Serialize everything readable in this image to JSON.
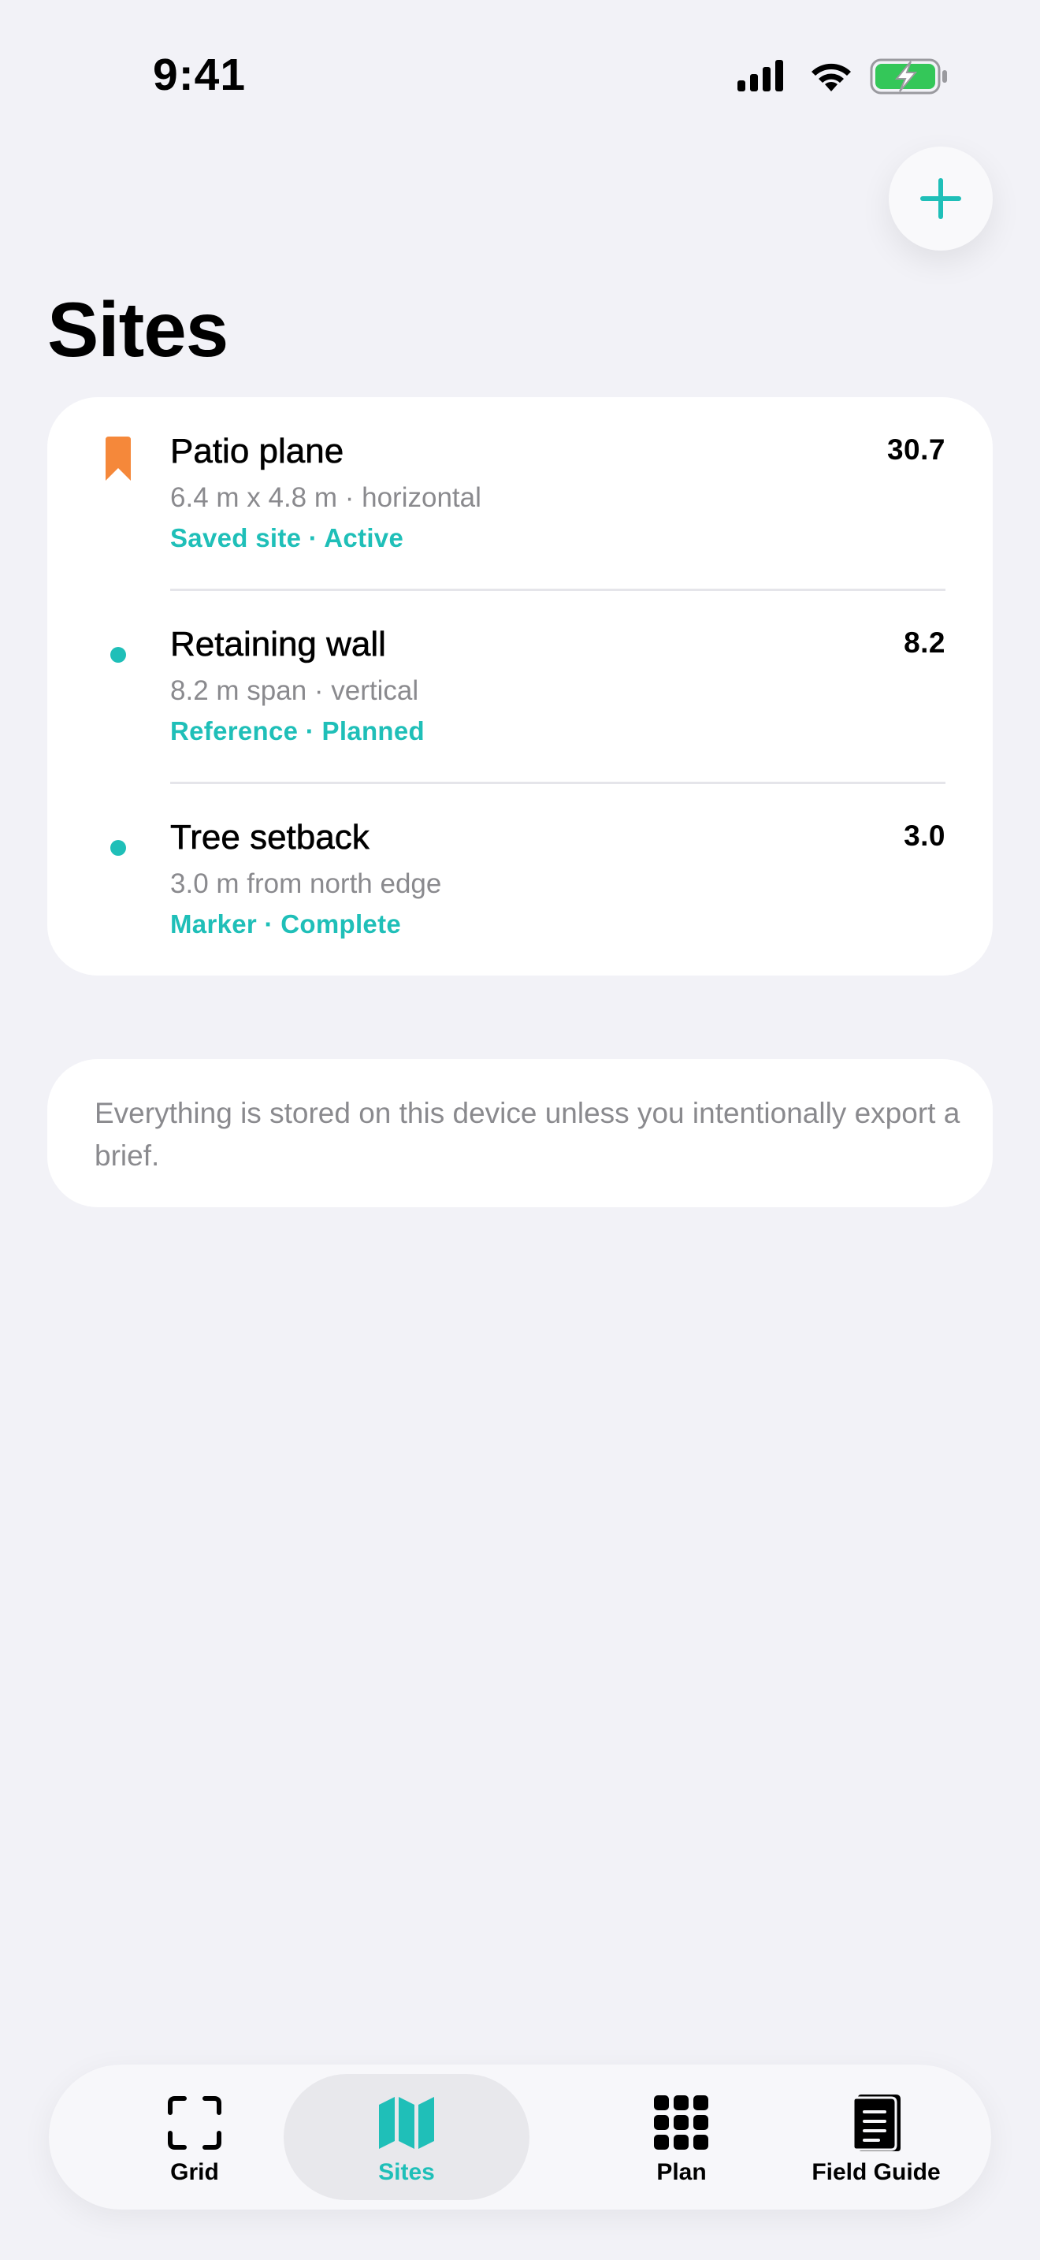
{
  "status_bar": {
    "time": "9:41"
  },
  "header": {
    "title": "Sites",
    "add_icon": "plus-icon"
  },
  "sites": [
    {
      "name": "Patio plane",
      "detail": "6.4 m x 4.8 m · horizontal",
      "status": "Saved site · Active",
      "value": "30.7",
      "marker": "bookmark-icon",
      "marker_color": "#f5883a"
    },
    {
      "name": "Retaining wall",
      "detail": "8.2 m span · vertical",
      "status": "Reference · Planned",
      "value": "8.2",
      "marker": "dot",
      "marker_color": "#1fbfb8"
    },
    {
      "name": "Tree setback",
      "detail": "3.0 m from north edge",
      "status": "Marker · Complete",
      "value": "3.0",
      "marker": "dot",
      "marker_color": "#1fbfb8"
    }
  ],
  "privacy_note": "Everything is stored on this device unless you intentionally export a brief.",
  "tab_bar": {
    "tabs": [
      {
        "label": "Grid",
        "icon": "viewfinder-icon",
        "active": false
      },
      {
        "label": "Sites",
        "icon": "map-icon",
        "active": true
      },
      {
        "label": "Plan",
        "icon": "grid-icon",
        "active": false
      },
      {
        "label": "Field Guide",
        "icon": "notebook-icon",
        "active": false
      }
    ]
  },
  "colors": {
    "accent": "#1fbfb8",
    "bookmark": "#f5883a",
    "background": "#f2f2f7",
    "secondary_text": "#8a8a8e"
  }
}
